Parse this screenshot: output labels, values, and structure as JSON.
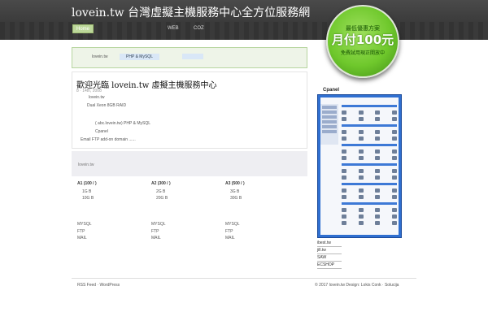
{
  "header": {
    "site_title": "lovein.tw 台灣虛擬主機服務中心全方位服務網",
    "nav": {
      "home": "Home",
      "web": "WEB",
      "coz": "COZ"
    }
  },
  "promo": {
    "line1": "最低優惠方案",
    "line2": "月付100元",
    "line3": "免費試用現正開放中"
  },
  "notice": {
    "item1": "lovein.tw",
    "item2": "PHP & MySQL"
  },
  "post": {
    "title": "歡迎光臨 lovein.tw 虛擬主機服務中心",
    "date": "8  ·  14th, 2008",
    "line1": "lovein.tw",
    "line2": "Dual Xeon      8GB      RAID",
    "line3": "( abc.lovein.tw)   PHP & MySQL",
    "line4": "Cpanel",
    "line5": "Email FTP   add-on domain      ......"
  },
  "grey_box": {
    "label": "lovein.tw"
  },
  "plans": [
    {
      "head": "A1    (100     /   )",
      "p1": "1G B",
      "p2": "10G B",
      "f1": "MYSQL",
      "f2": "FTP",
      "f3": "MAIL"
    },
    {
      "head": "A2    (300     /   )",
      "p1": "2G B",
      "p2": "20G B",
      "f1": "MYSQL",
      "f2": "FTP",
      "f3": "MAIL"
    },
    {
      "head": "A3    (500     /   )",
      "p1": "3G B",
      "p2": "30G B",
      "f1": "MYSQL",
      "f2": "FTP",
      "f3": "MAIL"
    }
  ],
  "sidebar": {
    "title": "Cpanel",
    "links": [
      "ibest.tw",
      "jill.tw",
      "SAW",
      "ECSHOP"
    ]
  },
  "footer": {
    "left": "RSS Feed · WordPress",
    "right": "© 2017 lovein.tw                Design: Lokis Conk · Solucija"
  }
}
